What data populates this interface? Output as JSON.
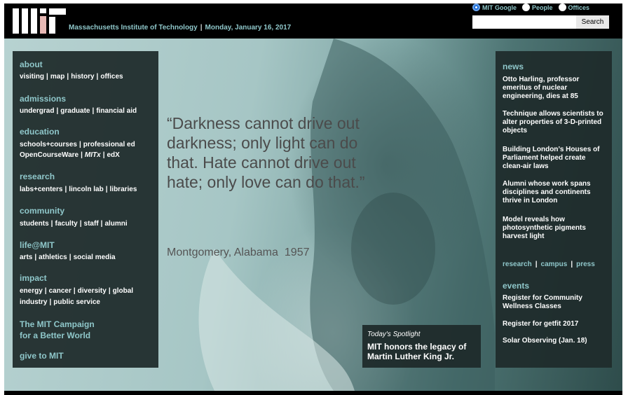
{
  "header": {
    "institution": "Massachusetts Institute of Technology",
    "separator": "|",
    "date": "Monday, January 16, 2017"
  },
  "search": {
    "options": [
      {
        "label": "MIT Google",
        "selected": true
      },
      {
        "label": "People",
        "selected": false
      },
      {
        "label": "Offices",
        "selected": false
      }
    ],
    "input_value": "",
    "button_label": "Search"
  },
  "leftnav": {
    "sections": [
      {
        "heading": "about",
        "lines": [
          [
            "visiting",
            "map",
            "history",
            "offices"
          ]
        ]
      },
      {
        "heading": "admissions",
        "lines": [
          [
            "undergrad",
            "graduate",
            "financial aid"
          ]
        ]
      },
      {
        "heading": "education",
        "lines": [
          [
            "schools+courses",
            "professional ed"
          ],
          [
            "OpenCourseWare",
            "MITx",
            "edX"
          ]
        ]
      },
      {
        "heading": "research",
        "lines": [
          [
            "labs+centers",
            "lincoln lab",
            "libraries"
          ]
        ]
      },
      {
        "heading": "community",
        "lines": [
          [
            "students",
            "faculty",
            "staff",
            "alumni"
          ]
        ]
      },
      {
        "heading": "life@MIT",
        "lines": [
          [
            "arts",
            "athletics",
            "social media"
          ]
        ]
      },
      {
        "heading": "impact",
        "lines": [
          [
            "energy",
            "cancer",
            "diversity",
            "global"
          ],
          [
            "industry",
            "public service"
          ]
        ]
      }
    ],
    "campaign_line1": "The MIT Campaign",
    "campaign_line2": "for a Better World",
    "give": "give to MIT",
    "link_separator": "|"
  },
  "quote": {
    "text": "“Darkness cannot drive out darkness; only light can do that. Hate cannot drive out hate; only love can do that.”",
    "place": "Montgomery, Alabama",
    "year": "1957"
  },
  "spotlight": {
    "label": "Today's Spotlight",
    "title": "MIT honors the legacy of Martin Luther King Jr."
  },
  "news": {
    "heading": "news",
    "items": [
      "Otto Harling, professor emeritus of nuclear engineering, dies at 85",
      "Technique allows scientists to alter properties of 3-D-printed objects",
      "Building London’s Houses of Parliament helped create clean-air laws",
      "Alumni whose work spans disciplines and continents thrive in London",
      "Model reveals how photosynthetic pigments harvest light"
    ],
    "links": [
      "research",
      "campus",
      "press"
    ],
    "link_separator": "|"
  },
  "events": {
    "heading": "events",
    "items": [
      "Register for Community Wellness Classes",
      "Register for getfit 2017",
      "Solar Observing (Jan. 18)"
    ]
  },
  "colors": {
    "accent": "#8fc7ca",
    "panel": "#1f2c2c",
    "header_bg": "#000000",
    "logo_red": "#e7b9b5"
  },
  "icons": [
    "mit-logo",
    "radio-selected-icon",
    "radio-unselected-icon"
  ]
}
